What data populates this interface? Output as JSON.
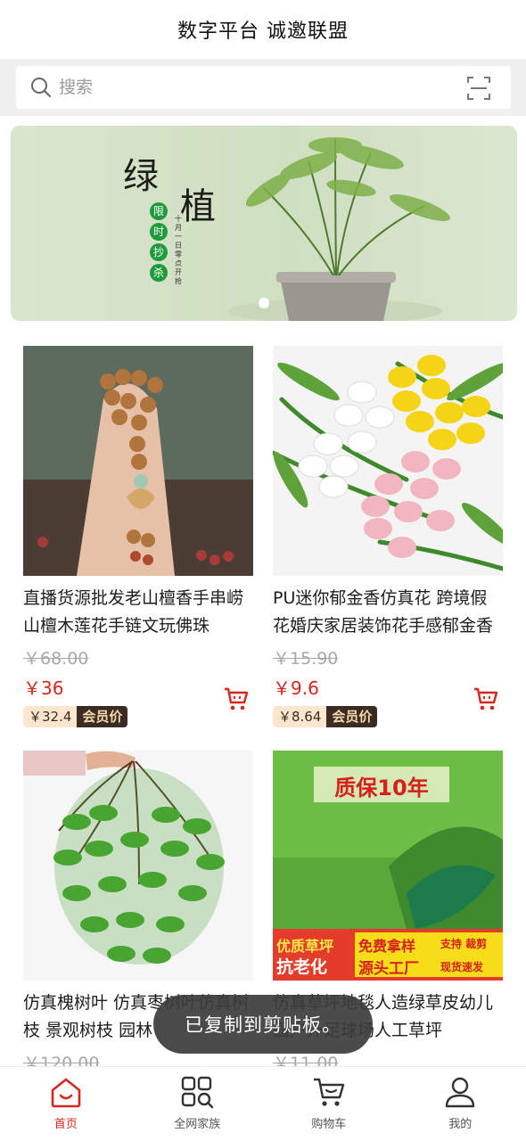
{
  "header": {
    "title": "数字平台 诚邀联盟"
  },
  "search": {
    "placeholder": "搜索"
  },
  "banner": {
    "title_char_1": "绿",
    "title_char_2": "植",
    "seal_chars": [
      "限",
      "时",
      "抄",
      "杀"
    ],
    "subtitle": "十月一日零点开抢"
  },
  "products": [
    {
      "name": "直播货源批发老山檀香手串崂山檀木莲花手链文玩佛珠",
      "original_price": "￥68.00",
      "price": "￥36",
      "member_price": "￥32.4",
      "member_label": "会员价"
    },
    {
      "name": "PU迷你郁金香仿真花 跨境假花婚庆家居装饰花手感郁金香",
      "original_price": "￥15.90",
      "price": "￥9.6",
      "member_price": "￥8.64",
      "member_label": "会员价"
    },
    {
      "name": "仿真槐树叶 仿真枣树叶仿真树枝 景观树枝 园林",
      "original_price": "￥120.00",
      "image_texts": []
    },
    {
      "name": "仿真草坪地毯人造绿草皮幼儿园户外足球场人工草坪",
      "original_price": "￥11.00",
      "image_texts": [
        "质保10年",
        "优质草坪",
        "抗老化",
        "免费拿样",
        "源头工厂",
        "支持 裁剪",
        "现货速发"
      ]
    }
  ],
  "toast": {
    "message": "已复制到剪贴板。"
  },
  "tabbar": {
    "items": [
      {
        "label": "首页",
        "icon": "home-icon",
        "active": true
      },
      {
        "label": "全网家族",
        "icon": "grid-search-icon",
        "active": false
      },
      {
        "label": "购物车",
        "icon": "cart-icon",
        "active": false
      },
      {
        "label": "我的",
        "icon": "user-icon",
        "active": false
      }
    ]
  },
  "colors": {
    "accent": "#d7261b",
    "member_bg": "#3a2b23",
    "member_text": "#f6d7a8"
  }
}
